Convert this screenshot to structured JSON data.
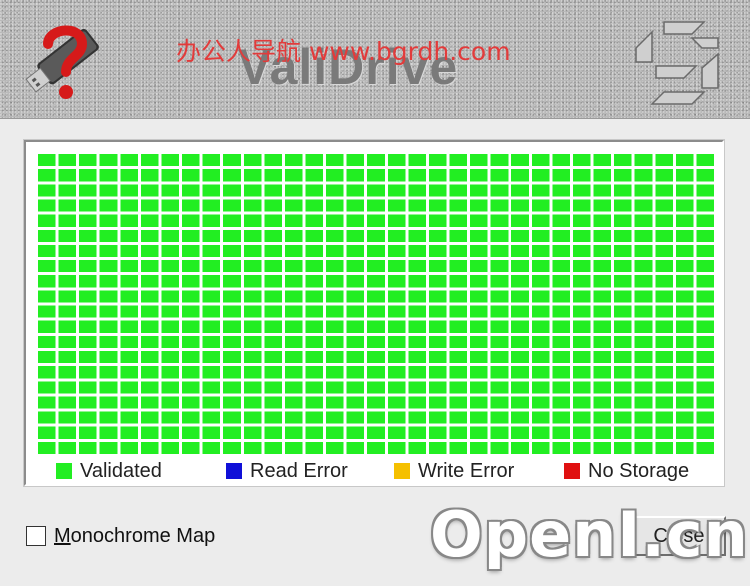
{
  "app": {
    "title": "ValiDrive"
  },
  "watermarks": {
    "top": "办公人导航 www.bgrdh.com",
    "bottom": "OpenI.cn"
  },
  "map": {
    "rows": 20,
    "cols": 33,
    "state": "validated",
    "colors": {
      "validated": "#22ee22",
      "read_error": "#1010d8",
      "write_error": "#f5c000",
      "no_storage": "#e01010"
    }
  },
  "legend": {
    "items": [
      {
        "label": "Validated",
        "color": "#22ee22"
      },
      {
        "label": "Read Error",
        "color": "#1010d8"
      },
      {
        "label": "Write Error",
        "color": "#f5c000"
      },
      {
        "label": "No Storage",
        "color": "#e01010"
      }
    ]
  },
  "controls": {
    "monochrome_label_underlined": "M",
    "monochrome_label_rest": "onochrome Map",
    "monochrome_checked": false,
    "close_label": "Close"
  },
  "icons": {
    "left_logo": "usb-drive-question-icon",
    "right_logo": "grc-logo-icon"
  }
}
